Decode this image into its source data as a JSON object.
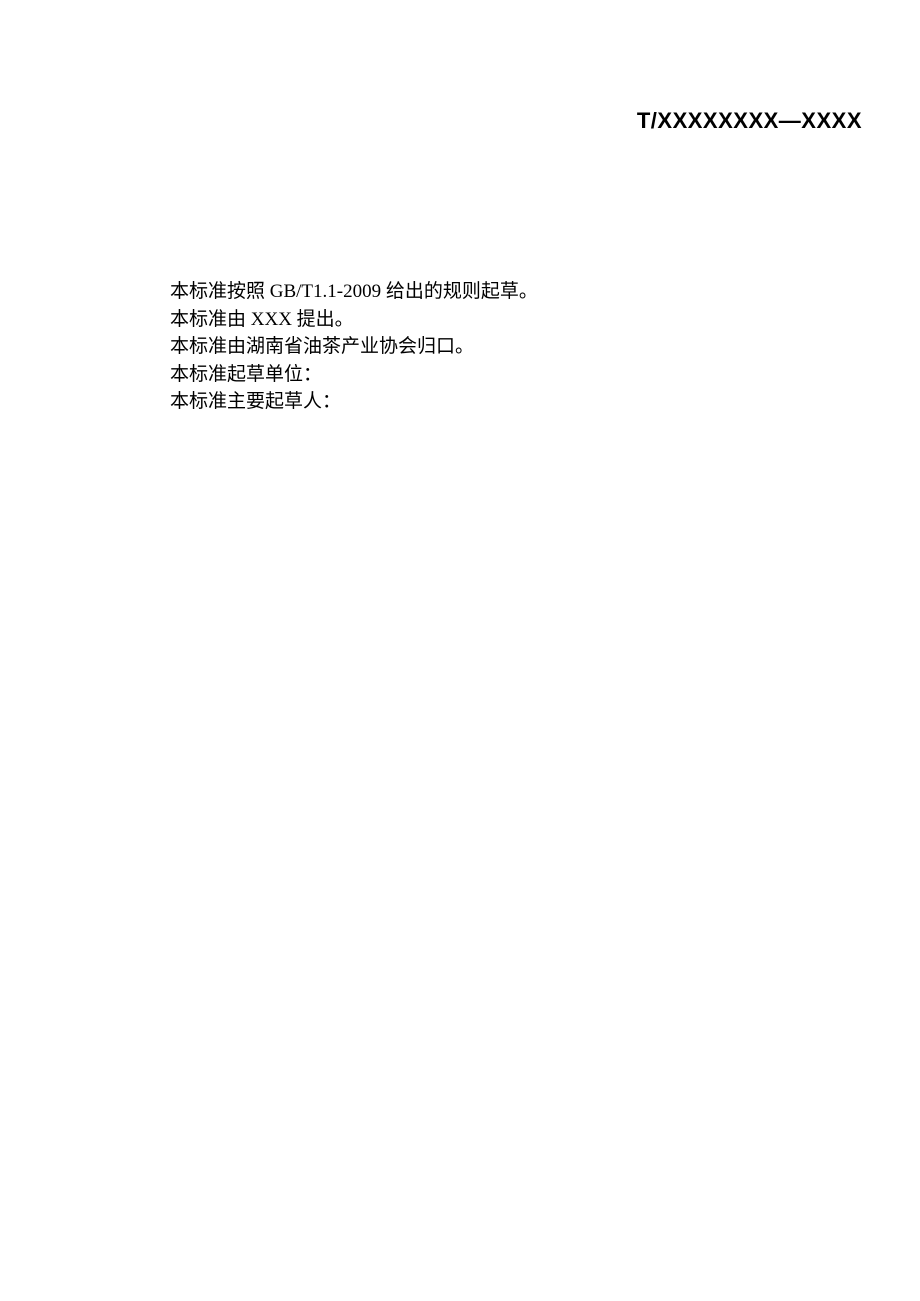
{
  "header": {
    "standard_code": "T/XXXXXXXX—XXXX"
  },
  "body": {
    "line1": "本标准按照 GB/T1.1-2009 给出的规则起草。",
    "line2": "本标准由 XXX 提出。",
    "line3": "本标准由湖南省油茶产业协会归口。",
    "line4": "本标准起草单位：",
    "line5": "本标准主要起草人："
  }
}
